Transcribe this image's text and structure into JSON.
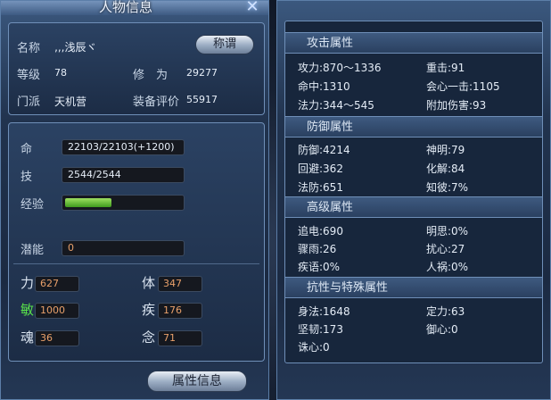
{
  "left_window": {
    "title": "人物信息",
    "close_glyph": "✕",
    "name_label": "名称",
    "name_value": "‚,,浅辰ヾ",
    "title_button": "称谓",
    "level_label": "等级",
    "level_value": "78",
    "cultivation_label": "修　为",
    "cultivation_value": "29277",
    "sect_label": "门派",
    "sect_value": "天机营",
    "gear_label": "装备评价",
    "gear_value": "55917",
    "hp_label": "命",
    "hp_value": "22103/22103(+1200)",
    "skill_label": "技",
    "skill_value": "2544/2544",
    "exp_label": "经验",
    "exp_fraction": 0.4,
    "potential_label": "潜能",
    "potential_value": "0",
    "attributes": [
      {
        "label": "力",
        "value": "627",
        "color": "#d9e3ef"
      },
      {
        "label": "体",
        "value": "347",
        "color": "#d9e3ef"
      },
      {
        "label": "敏",
        "value": "1000",
        "color": "#59e04a"
      },
      {
        "label": "疾",
        "value": "176",
        "color": "#d9e3ef"
      },
      {
        "label": "魂",
        "value": "36",
        "color": "#d9e3ef"
      },
      {
        "label": "念",
        "value": "71",
        "color": "#d9e3ef"
      }
    ],
    "footer_button": "属性信息"
  },
  "right_window": {
    "sections": [
      {
        "title": "攻击属性",
        "stats": [
          {
            "left": "攻力:870～1336",
            "right": "重击:91"
          },
          {
            "left": "命中:1310",
            "right": "会心一击:1105"
          },
          {
            "left": "法力:344～545",
            "right": "附加伤害:93"
          }
        ]
      },
      {
        "title": "防御属性",
        "stats": [
          {
            "left": "防御:4214",
            "right": "神明:79"
          },
          {
            "left": "回避:362",
            "right": "化解:84"
          },
          {
            "left": "法防:651",
            "right": "知彼:7%"
          }
        ]
      },
      {
        "title": "高级属性",
        "stats": [
          {
            "left": "追电:690",
            "right": "明思:0%"
          },
          {
            "left": "骤雨:26",
            "right": "扰心:27"
          },
          {
            "left": "疾语:0%",
            "right": "人祸:0%"
          }
        ]
      },
      {
        "title": "抗性与特殊属性",
        "stats": [
          {
            "left": "身法:1648",
            "right": "定力:63"
          },
          {
            "left": "坚韧:173",
            "right": "御心:0"
          },
          {
            "left": "诛心:0",
            "right": ""
          }
        ]
      }
    ]
  }
}
